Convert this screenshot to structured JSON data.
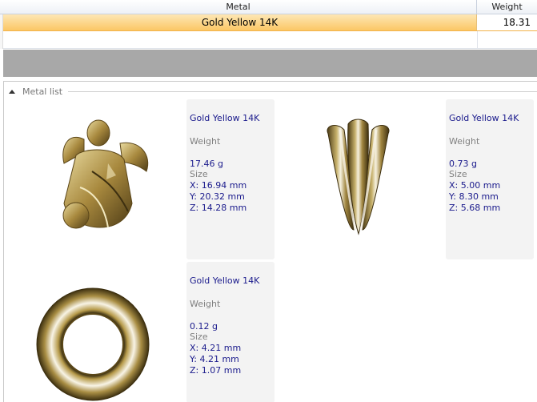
{
  "grid": {
    "columns": {
      "metal": "Metal",
      "weight": "Weight"
    },
    "rows": [
      {
        "metal": "Gold Yellow 14K",
        "weight": "18.31"
      }
    ]
  },
  "panel": {
    "title": "Metal list"
  },
  "items": [
    {
      "metal": "Gold Yellow 14K",
      "weight_label": "Weight",
      "weight": "17.46 g",
      "size_label": "Size",
      "x": "X: 16.94 mm",
      "y": "Y: 20.32 mm",
      "z": "Z: 14.28 mm"
    },
    {
      "metal": "Gold Yellow 14K",
      "weight_label": "Weight",
      "weight": "0.73 g",
      "size_label": "Size",
      "x": "X: 5.00 mm",
      "y": "Y: 8.30 mm",
      "z": "Z: 5.68 mm"
    },
    {
      "metal": "Gold Yellow 14K",
      "weight_label": "Weight",
      "weight": "0.12 g",
      "size_label": "Size",
      "x": "X: 4.21 mm",
      "y": "Y: 4.21 mm",
      "z": "Z: 1.07 mm"
    }
  ],
  "colors": {
    "gold": "#b39a4d",
    "selection": "#fbc765",
    "info_blue": "#1a1a8c"
  }
}
